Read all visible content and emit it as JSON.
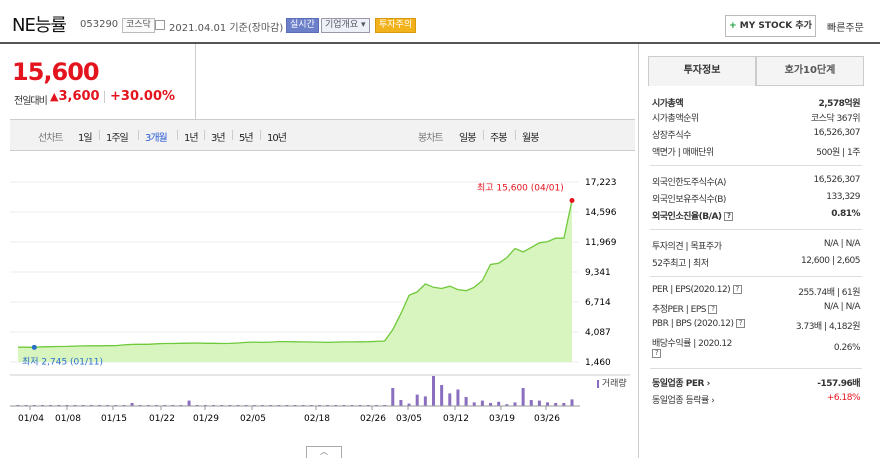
{
  "header": {
    "title": "NE능률",
    "code": "053290",
    "market_tag": "코스닥",
    "date": "2021.04.01 기준(장마감)",
    "realtime_tag": "실시간",
    "company_tag": "기업개요",
    "caution_tag": "투자주의",
    "mystock_label": "MY STOCK 추가",
    "quick_order": "빠른주문"
  },
  "price": {
    "current": "15,600",
    "change_label": "전일대비",
    "change": "3,600",
    "change_pct": "+30.00%",
    "colors": {
      "up": "#e4141e"
    }
  },
  "chart_tabs": {
    "line_label": "선차트",
    "periods": [
      "1일",
      "1주일",
      "3개월",
      "1년",
      "3년",
      "5년",
      "10년"
    ],
    "active_period": "3개월",
    "candle_label": "봉차트",
    "candles": [
      "일봉",
      "주봉",
      "월봉"
    ]
  },
  "right_panel": {
    "tabs": [
      "투자정보",
      "호가10단계"
    ],
    "rows": [
      {
        "k": "시가총액",
        "v": "2,578억원"
      },
      {
        "k": "시가총액순위",
        "v": "코스닥 367위"
      },
      {
        "k": "상장주식수",
        "v": "16,526,307"
      },
      {
        "k": "액면가 | 매매단위",
        "v": "500원 | 1주"
      },
      {
        "k": "외국인한도주식수(A)",
        "v": "16,526,307"
      },
      {
        "k": "외국인보유주식수(B)",
        "v": "133,329"
      },
      {
        "k": "외국인소진율(B/A)",
        "v": "0.81%"
      },
      {
        "k": "투자의견 | 목표주가",
        "v": "N/A | N/A"
      },
      {
        "k": "52주최고 | 최저",
        "v": "12,600 | 2,605"
      },
      {
        "k": "PER | EPS(2020.12)",
        "v": "255.74배 | 61원"
      },
      {
        "k": "추정PER | EPS",
        "v": "N/A | N/A"
      },
      {
        "k": "PBR | BPS (2020.12)",
        "v": "3.73배 | 4,182원"
      },
      {
        "k": "배당수익률 | 2020.12",
        "v": "0.26%"
      },
      {
        "k": "동일업종 PER",
        "v": "-157.96배"
      },
      {
        "k": "동일업종 등락률",
        "v": "+6.18%"
      }
    ]
  },
  "chart_data": {
    "type": "area",
    "high_label": "최고 15,600 (04/01)",
    "low_label": "최저 2,745 (01/11)",
    "y_ticks": [
      "17,223",
      "14,596",
      "11,969",
      "9,341",
      "6,714",
      "4,087",
      "1,460"
    ],
    "ylim": [
      1460,
      17223
    ],
    "x_ticks": [
      "01/04",
      "01/08",
      "01/15",
      "01/22",
      "01/29",
      "02/05",
      "02/18",
      "02/26",
      "03/05",
      "03/12",
      "03/19",
      "03/26"
    ],
    "volume_label": "거래량",
    "values": [
      2760,
      2760,
      2745,
      2790,
      2800,
      2820,
      2830,
      2850,
      2870,
      2880,
      2880,
      2890,
      2900,
      2960,
      3000,
      3010,
      3010,
      3050,
      3080,
      3080,
      3100,
      3110,
      3120,
      3100,
      3100,
      3080,
      3090,
      3120,
      3180,
      3200,
      3180,
      3200,
      3250,
      3250,
      3230,
      3220,
      3210,
      3200,
      3180,
      3200,
      3220,
      3220,
      3230,
      3240,
      3260,
      3300,
      4300,
      5700,
      7300,
      7600,
      8300,
      8000,
      7900,
      8100,
      7800,
      7700,
      8000,
      8600,
      10000,
      10100,
      10600,
      11400,
      11100,
      11500,
      11900,
      12000,
      12300,
      12300,
      15600
    ],
    "volume": [
      0.01,
      0.01,
      0.01,
      0.01,
      0.01,
      0.01,
      0.01,
      0.02,
      0.02,
      0.02,
      0.01,
      0.01,
      0.01,
      0.01,
      0.1,
      0.03,
      0.02,
      0.02,
      0.02,
      0.03,
      0.01,
      0.18,
      0.03,
      0.02,
      0.02,
      0.03,
      0.02,
      0.02,
      0.01,
      0.01,
      0.01,
      0.01,
      0.01,
      0.01,
      0.01,
      0.01,
      0.01,
      0.01,
      0.01,
      0.01,
      0.01,
      0.01,
      0.01,
      0.01,
      0.01,
      0.01,
      0.6,
      0.2,
      0.08,
      0.38,
      0.32,
      1.0,
      0.7,
      0.42,
      0.55,
      0.3,
      0.12,
      0.18,
      0.1,
      0.14,
      0.06,
      0.12,
      0.6,
      0.2,
      0.18,
      0.12,
      0.1,
      0.1,
      0.22
    ],
    "colors": {
      "line": "#6fc93a",
      "fill": "#d8f5c0",
      "volume": "#8a6fc1",
      "high": "#e4141e",
      "low": "#2a6fc9"
    }
  }
}
